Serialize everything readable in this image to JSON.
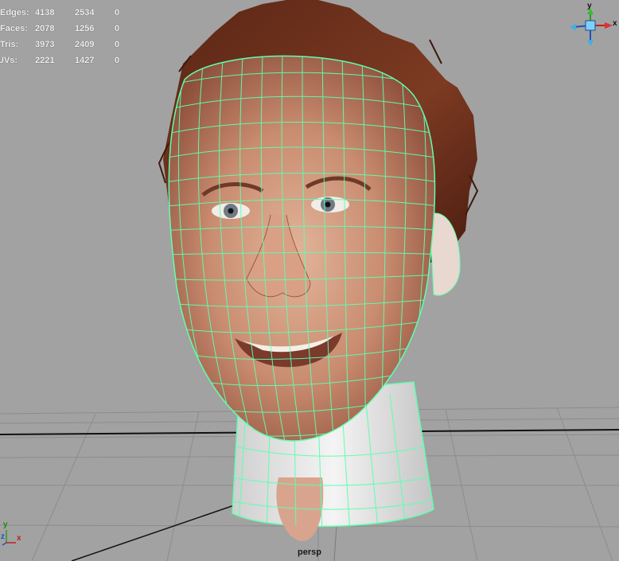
{
  "hud": {
    "rows": [
      {
        "label": "Edges:",
        "v1": "4138",
        "v2": "2534",
        "v3": "0"
      },
      {
        "label": "Faces:",
        "v1": "2078",
        "v2": "1256",
        "v3": "0"
      },
      {
        "label": "Tris:",
        "v1": "3973",
        "v2": "2409",
        "v3": "0"
      },
      {
        "label": "UVs:",
        "v1": "2221",
        "v2": "1427",
        "v3": "0"
      }
    ]
  },
  "viewport": {
    "camera_name": "persp",
    "background_color": "#a2a2a2",
    "wireframe_color": "#5fffb0",
    "grid_color": "#8c8c8c"
  },
  "view_cube": {
    "x_label": "x",
    "y_label": "y",
    "icon": "view-cube-icon"
  },
  "origin_axis": {
    "x_label": "x",
    "y_label": "y",
    "z_label": "z",
    "icon": "axis-gizmo-icon"
  }
}
